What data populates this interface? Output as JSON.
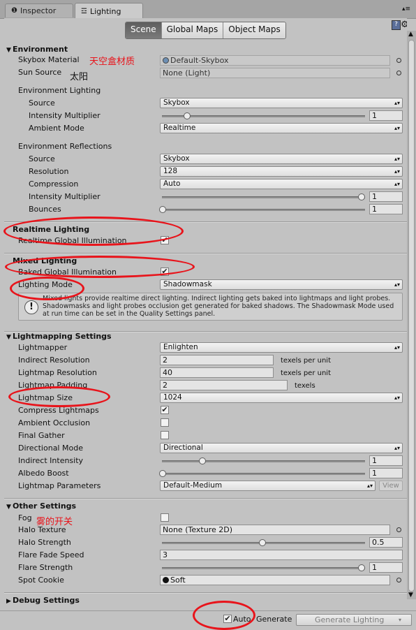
{
  "tabs": [
    {
      "label": "Inspector",
      "icon": "info-icon"
    },
    {
      "label": "Lighting",
      "icon": "lighting-icon"
    }
  ],
  "toggle": [
    "Scene",
    "Global Maps",
    "Object Maps"
  ],
  "environment": {
    "header": "Environment",
    "skybox_label": "Skybox Material",
    "skybox_value": "Default-Skybox",
    "skybox_note": "天空盒材质",
    "sun_label": "Sun Source",
    "sun_value": "None (Light)",
    "sun_note": "太阳",
    "lighting_header": "Environment Lighting",
    "source_label": "Source",
    "source_value": "Skybox",
    "intensity_label": "Intensity Multiplier",
    "intensity_value": "1",
    "ambient_label": "Ambient Mode",
    "ambient_value": "Realtime",
    "reflections_header": "Environment Reflections",
    "ref_source_label": "Source",
    "ref_source_value": "Skybox",
    "resolution_label": "Resolution",
    "resolution_value": "128",
    "compression_label": "Compression",
    "compression_value": "Auto",
    "ref_intensity_label": "Intensity Multiplier",
    "ref_intensity_value": "1",
    "bounces_label": "Bounces",
    "bounces_value": "1"
  },
  "realtime": {
    "header": "Realtime Lighting",
    "gi_label": "Realtime Global Illumination"
  },
  "mixed": {
    "header": "Mixed Lighting",
    "baked_label": "Baked Global Illumination",
    "mode_label": "Lighting Mode",
    "mode_value": "Shadowmask",
    "help_text": "Mixed lights provide realtime direct lighting. Indirect lighting gets baked into lightmaps and light probes. Shadowmasks and light probes occlusion get generated for baked shadows. The Shadowmask Mode used at run time can be set in the Quality Settings panel."
  },
  "lightmapping": {
    "header": "Lightmapping Settings",
    "lightmapper_label": "Lightmapper",
    "lightmapper_value": "Enlighten",
    "indirect_res_label": "Indirect Resolution",
    "indirect_res_value": "2",
    "texels_unit": "texels per unit",
    "lightmap_res_label": "Lightmap Resolution",
    "lightmap_res_value": "40",
    "padding_label": "Lightmap Padding",
    "padding_value": "2",
    "texels": "texels",
    "size_label": "Lightmap Size",
    "size_value": "1024",
    "compress_label": "Compress Lightmaps",
    "ao_label": "Ambient Occlusion",
    "final_gather_label": "Final Gather",
    "directional_label": "Directional Mode",
    "directional_value": "Directional",
    "indirect_int_label": "Indirect Intensity",
    "indirect_int_value": "1",
    "albedo_label": "Albedo Boost",
    "albedo_value": "1",
    "params_label": "Lightmap Parameters",
    "params_value": "Default-Medium",
    "view_label": "View"
  },
  "other": {
    "header": "Other Settings",
    "fog_label": "Fog",
    "fog_note": "雾的开关",
    "halo_tex_label": "Halo Texture",
    "halo_tex_value": "None (Texture 2D)",
    "halo_str_label": "Halo Strength",
    "halo_str_value": "0.5",
    "flare_fade_label": "Flare Fade Speed",
    "flare_fade_value": "3",
    "flare_str_label": "Flare Strength",
    "flare_str_value": "1",
    "cookie_label": "Spot Cookie",
    "cookie_value": "Soft"
  },
  "debug": {
    "header": "Debug Settings"
  },
  "footer": {
    "auto_label": "Auto",
    "generate_label": "Generate",
    "button_label": "Generate Lighting"
  },
  "colors": {
    "annotation": "#e8141b",
    "selected_toggle": "#6a6a6a"
  }
}
